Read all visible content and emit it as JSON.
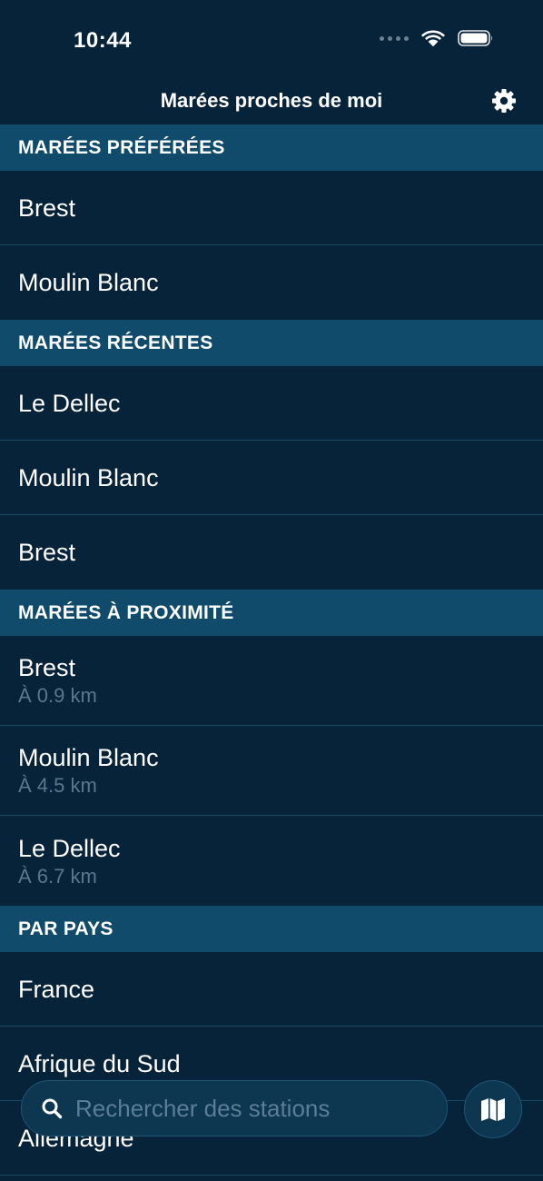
{
  "status_bar": {
    "time": "10:44",
    "icons": [
      "signal-dots-icon",
      "wifi-icon",
      "battery-icon"
    ]
  },
  "nav": {
    "title": "Marées proches de moi",
    "settings_icon": "gear-icon"
  },
  "sections": [
    {
      "title": "MARÉES PRÉFÉRÉES",
      "rows": [
        {
          "title": "Brest"
        },
        {
          "title": "Moulin Blanc"
        }
      ]
    },
    {
      "title": "MARÉES RÉCENTES",
      "rows": [
        {
          "title": "Le Dellec"
        },
        {
          "title": "Moulin Blanc"
        },
        {
          "title": "Brest"
        }
      ]
    },
    {
      "title": "MARÉES À PROXIMITÉ",
      "rows": [
        {
          "title": "Brest",
          "subtitle": "À 0.9 km"
        },
        {
          "title": "Moulin Blanc",
          "subtitle": "À 4.5 km"
        },
        {
          "title": "Le Dellec",
          "subtitle": "À 6.7 km"
        }
      ]
    },
    {
      "title": "PAR PAYS",
      "rows": [
        {
          "title": "France"
        },
        {
          "title": "Afrique du Sud"
        },
        {
          "title": "Allemagne"
        }
      ]
    }
  ],
  "search": {
    "placeholder": "Rechercher des stations",
    "value": "",
    "icon": "search-icon"
  },
  "map_button": {
    "icon": "map-icon"
  },
  "colors": {
    "background": "#06233a",
    "section_header": "#104b6b",
    "secondary_text": "#58788e",
    "search_background": "#0d3650"
  }
}
